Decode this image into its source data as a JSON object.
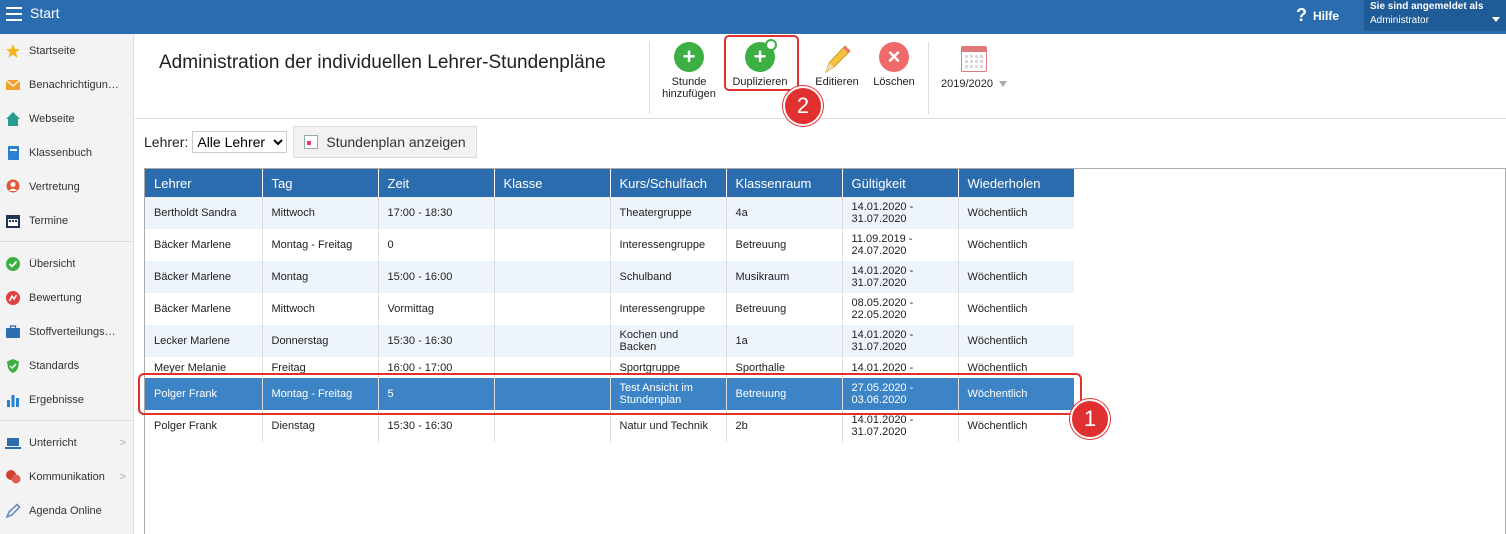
{
  "topbar": {
    "app_title": "Start",
    "help_label": "Hilfe",
    "user_line1": "Sie sind angemeldet als",
    "user_line2": "Administrator"
  },
  "sidebar": {
    "items": [
      {
        "label": "Startseite",
        "icon": "star-icon",
        "color": "#f5b51d"
      },
      {
        "label": "Benachrichtigungen",
        "icon": "envelope-icon",
        "color": "#f0a030"
      },
      {
        "label": "Webseite",
        "icon": "home-icon",
        "color": "#2a9d8f"
      },
      {
        "label": "Klassenbuch",
        "icon": "book-icon",
        "color": "#2a7fd0"
      },
      {
        "label": "Vertretung",
        "icon": "person-icon",
        "color": "#e05a3a"
      },
      {
        "label": "Termine",
        "icon": "calendar-icon",
        "color": "#223355"
      },
      {
        "label": "Übersicht",
        "icon": "check-circle-icon",
        "color": "#3cb043"
      },
      {
        "label": "Bewertung",
        "icon": "rating-icon",
        "color": "#e04040"
      },
      {
        "label": "Stoffverteilungsplan",
        "icon": "briefcase-icon",
        "color": "#2a6cad"
      },
      {
        "label": "Standards",
        "icon": "shield-icon",
        "color": "#3cb043"
      },
      {
        "label": "Ergebnisse",
        "icon": "bar-chart-icon",
        "color": "#2a7fd0"
      },
      {
        "label": "Unterricht",
        "icon": "laptop-icon",
        "color": "#2a6cad"
      },
      {
        "label": "Kommunikation",
        "icon": "chat-icon",
        "color": "#d04030"
      },
      {
        "label": "Agenda Online",
        "icon": "pen-icon",
        "color": "#6a8bc0"
      }
    ]
  },
  "header": {
    "title": "Administration der individuellen Lehrer-Stundenpläne",
    "add_line1": "Stunde",
    "add_line2": "hinzufügen",
    "duplicate": "Duplizieren",
    "edit": "Editieren",
    "delete": "Löschen",
    "year": "2019/2020"
  },
  "filter": {
    "label": "Lehrer:",
    "selected": "Alle Lehrer",
    "show_button": "Stundenplan anzeigen"
  },
  "table": {
    "columns": [
      "Lehrer",
      "Tag",
      "Zeit",
      "Klasse",
      "Kurs/Schulfach",
      "Klassenraum",
      "Gültigkeit",
      "Wiederholen"
    ],
    "rows": [
      [
        "Bertholdt Sandra",
        "Mittwoch",
        "17:00 - 18:30",
        "",
        "Theatergruppe",
        "4a",
        "14.01.2020 - 31.07.2020",
        "Wöchentlich"
      ],
      [
        "Bäcker Marlene",
        "Montag - Freitag",
        "0",
        "",
        "Interessengruppe",
        "Betreuung",
        "11.09.2019 - 24.07.2020",
        "Wöchentlich"
      ],
      [
        "Bäcker Marlene",
        "Montag",
        "15:00 - 16:00",
        "",
        "Schulband",
        "Musikraum",
        "14.01.2020 - 31.07.2020",
        "Wöchentlich"
      ],
      [
        "Bäcker Marlene",
        "Mittwoch",
        "Vormittag",
        "",
        "Interessengruppe",
        "Betreuung",
        "08.05.2020 - 22.05.2020",
        "Wöchentlich"
      ],
      [
        "Lecker Marlene",
        "Donnerstag",
        "15:30 - 16:30",
        "",
        "Kochen und Backen",
        "1a",
        "14.01.2020 - 31.07.2020",
        "Wöchentlich"
      ],
      [
        "Meyer Melanie",
        "Freitag",
        "16:00 - 17:00",
        "",
        "Sportgruppe",
        "Sporthalle",
        "14.01.2020 -",
        "Wöchentlich"
      ],
      [
        "Polger Frank",
        "Montag - Freitag",
        "5",
        "",
        "Test Ansicht im Stundenplan",
        "Betreuung",
        "27.05.2020 - 03.06.2020",
        "Wöchentlich"
      ],
      [
        "Polger Frank",
        "Dienstag",
        "15:30 - 16:30",
        "",
        "Natur und Technik",
        "2b",
        "14.01.2020 - 31.07.2020",
        "Wöchentlich"
      ]
    ]
  },
  "annotations": {
    "badge1": "1",
    "badge2": "2"
  },
  "colors": {
    "accent": "#2a6cad",
    "selected_row": "#3d84c6",
    "highlight": "#e03030"
  }
}
